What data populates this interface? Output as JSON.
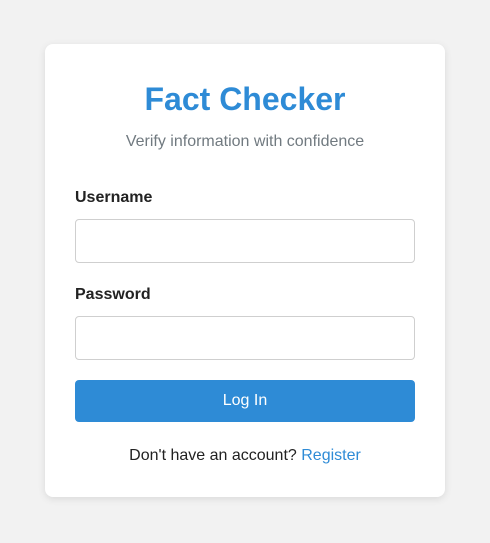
{
  "app": {
    "title": "Fact Checker",
    "subtitle": "Verify information with confidence"
  },
  "form": {
    "username_label": "Username",
    "username_value": "",
    "password_label": "Password",
    "password_value": "",
    "login_button": "Log In"
  },
  "footer": {
    "prompt": "Don't have an account?",
    "register_link": "Register"
  },
  "colors": {
    "accent": "#2e8bd6",
    "background": "#f2f2f2",
    "card": "#ffffff",
    "subtitle": "#717a80"
  }
}
